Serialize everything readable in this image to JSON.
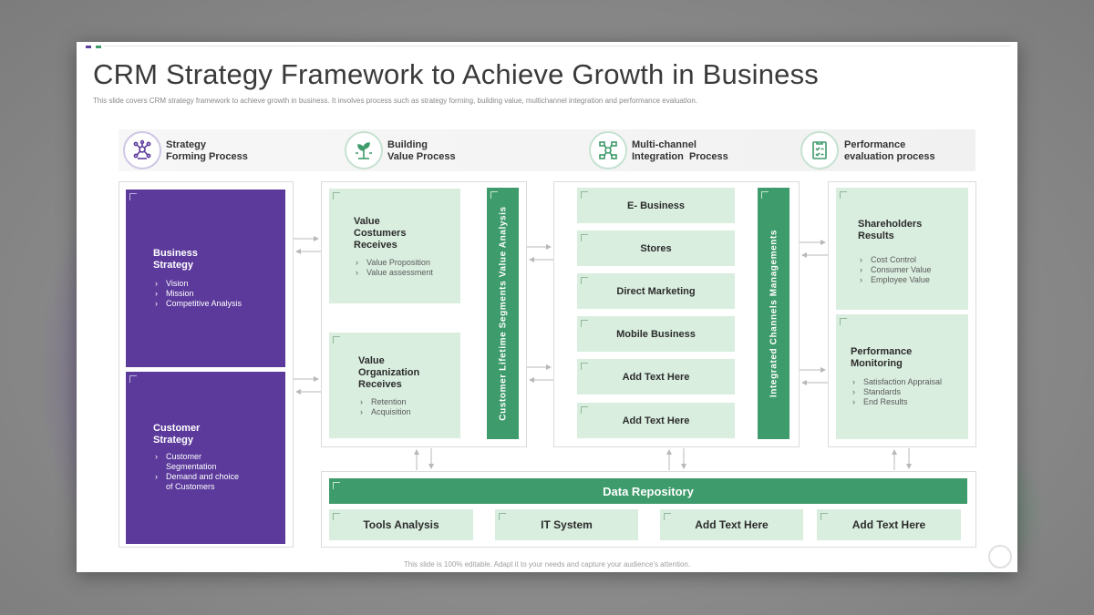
{
  "title": "CRM Strategy Framework to Achieve Growth in Business",
  "subtitle": "This slide covers CRM strategy framework to achieve growth in business. It involves process such as strategy forming, building value, multichannel integration and performance evaluation.",
  "footer": "This slide is 100% editable. Adapt it to your needs and capture your audience's attention.",
  "colors": {
    "purple": "#5b3a9b",
    "green": "#3e9b6b",
    "light_green": "#d9eedf"
  },
  "headers": [
    {
      "label": "Strategy\nForming Process",
      "icon": "network-cluster-icon"
    },
    {
      "label": "Building\nValue Process",
      "icon": "plant-growth-icon"
    },
    {
      "label": "Multi-channel\nIntegration  Process",
      "icon": "channel-hub-icon"
    },
    {
      "label": "Performance\nevaluation process",
      "icon": "checklist-report-icon"
    }
  ],
  "strategy": [
    {
      "title": "Business\nStrategy",
      "bullets": [
        "Vision",
        "Mission",
        "Competitive Analysis"
      ]
    },
    {
      "title": "Customer\nStrategy",
      "bullets": [
        "Customer\nSegmentation",
        "Demand and choice\nof Customers"
      ]
    }
  ],
  "value": {
    "boxes": [
      {
        "title": "Value\nCostumers\nReceives",
        "bullets": [
          "Value Proposition",
          "Value assessment"
        ]
      },
      {
        "title": "Value\nOrganization\nReceives",
        "bullets": [
          "Retention",
          "Acquisition"
        ]
      }
    ],
    "vertical_label": "Customer Lifetime Segments Value Analysis"
  },
  "multichannel": {
    "items": [
      "E- Business",
      "Stores",
      "Direct Marketing",
      "Mobile Business",
      "Add Text Here",
      "Add Text Here"
    ],
    "vertical_label": "Integrated  Channels Managements"
  },
  "performance": [
    {
      "title": "Shareholders\nResults",
      "bullets": [
        "Cost Control",
        "Consumer Value",
        "Employee Value"
      ]
    },
    {
      "title": "Performance\nMonitoring",
      "bullets": [
        "Satisfaction Appraisal",
        "Standards",
        "End Results"
      ]
    }
  ],
  "repository": {
    "title": "Data Repository",
    "items": [
      "Tools Analysis",
      "IT System",
      "Add Text Here",
      "Add Text Here"
    ]
  }
}
